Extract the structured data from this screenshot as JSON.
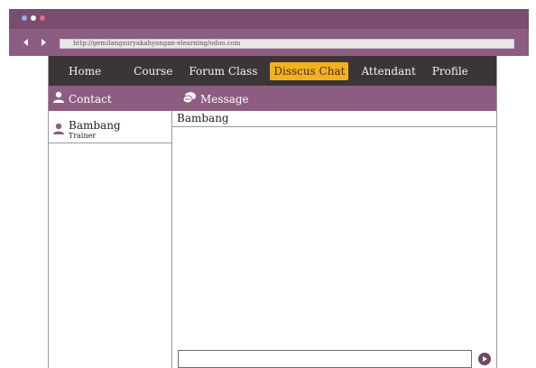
{
  "browser": {
    "dot_colors": [
      "#8fb0e8",
      "#f2f2f2",
      "#e06a8e"
    ],
    "url": "http://gemilangsuryakahyangan-elearning/odoo.com"
  },
  "menu": {
    "items": [
      "Home",
      "Course",
      "Forum Class",
      "Disscus Chat",
      "Attendant",
      "Profile"
    ],
    "active_index": 3
  },
  "sections": {
    "contact": "Contact",
    "message": "Message"
  },
  "contacts": [
    {
      "name": "Bambang",
      "role": "Trainer"
    }
  ],
  "chat": {
    "recipient": "Bambang",
    "input_value": ""
  },
  "colors": {
    "purple": "#8c5d80",
    "menu_bg": "#3c3538",
    "active": "#f2b21e"
  }
}
